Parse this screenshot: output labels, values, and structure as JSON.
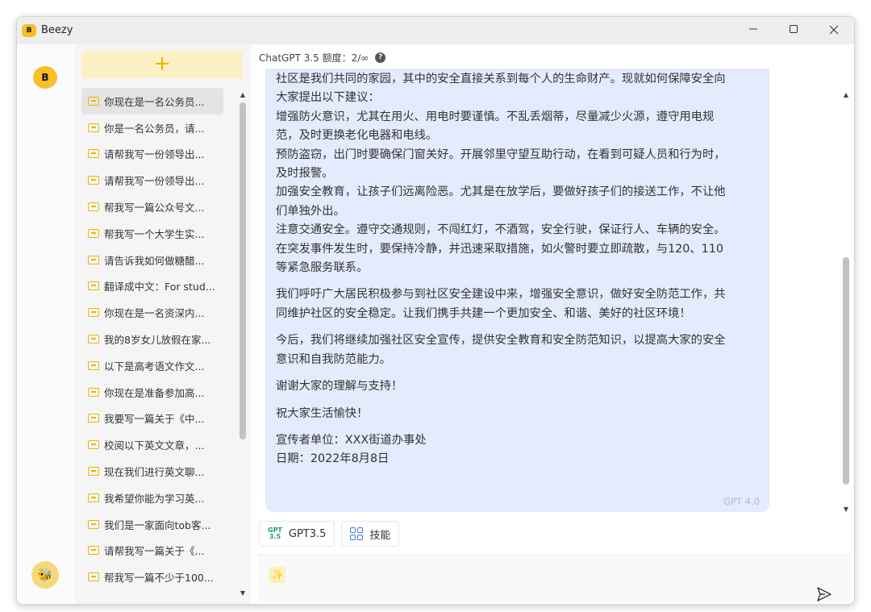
{
  "window": {
    "title": "Beezy"
  },
  "icons": {
    "app_logo": "beezy-logo-icon",
    "minimize": "minimize-icon",
    "maximize": "maximize-icon",
    "close": "close-icon",
    "new_chat": "plus-icon",
    "chat": "chat-bubble-icon",
    "help": "question-icon",
    "bee": "bee-icon",
    "wand": "magic-wand-icon",
    "send": "send-icon",
    "skills": "grid-icon"
  },
  "glyphs": {
    "app_logo": "B",
    "new_chat": "+",
    "help": "?",
    "wand": "✨",
    "bee": "🐝"
  },
  "colors": {
    "accent": "#f6c029",
    "message_bg": "#e3ebfc",
    "gpt_tag": "#a8bddf",
    "skill_icon": "#3d7be0",
    "gpt_badge": "#19a163"
  },
  "sidebar": {
    "items": [
      {
        "label": "你现在是一名公务员..."
      },
      {
        "label": "你是一名公务员，请..."
      },
      {
        "label": "请帮我写一份领导出..."
      },
      {
        "label": "请帮我写一份领导出..."
      },
      {
        "label": "帮我写一篇公众号文..."
      },
      {
        "label": "帮我写一个大学生实..."
      },
      {
        "label": "请告诉我如何做糖醋..."
      },
      {
        "label": "翻译成中文：For stud..."
      },
      {
        "label": "你现在是一名资深内..."
      },
      {
        "label": "我的8岁女儿放假在家..."
      },
      {
        "label": "以下是高考语文作文..."
      },
      {
        "label": "你现在是准备参加高..."
      },
      {
        "label": "我要写一篇关于《中..."
      },
      {
        "label": "校阅以下英文文章，..."
      },
      {
        "label": "现在我们进行英文聊..."
      },
      {
        "label": "我希望你能为学习英..."
      },
      {
        "label": "我们是一家面向tob客..."
      },
      {
        "label": "请帮我写一篇关于《..."
      },
      {
        "label": "帮我写一篇不少于100..."
      }
    ]
  },
  "main": {
    "model_quota": "ChatGPT 3.5 额度：2/∞",
    "message": {
      "paragraphs": [
        [
          "社区是我们共同的家园，其中的安全直接关系到每个人的生命财产。现就如何保障安全向",
          "大家提出以下建议：",
          "增强防火意识，尤其在用火、用电时要谨慎。不乱丢烟蒂，尽量减少火源，遵守用电规",
          "范，及时更换老化电器和电线。",
          "预防盗窃，出门时要确保门窗关好。开展邻里守望互助行动，在看到可疑人员和行为时，",
          "及时报警。",
          "加强安全教育，让孩子们远离险恶。尤其是在放学后，要做好孩子们的接送工作，不让他",
          "们单独外出。",
          "注意交通安全。遵守交通规则，不闯红灯，不酒驾，安全行驶，保证行人、车辆的安全。",
          "在突发事件发生时，要保持冷静，并迅速采取措施，如火警时要立即疏散，与120、110",
          "等紧急服务联系。"
        ],
        [
          "我们呼吁广大居民积极参与到社区安全建设中来，增强安全意识，做好安全防范工作，共",
          "同维护社区的安全稳定。让我们携手共建一个更加安全、和谐、美好的社区环境！"
        ],
        [
          "今后，我们将继续加强社区安全宣传，提供安全教育和安全防范知识，以提高大家的安全",
          "意识和自我防范能力。"
        ],
        [
          "谢谢大家的理解与支持！"
        ],
        [
          "祝大家生活愉快！"
        ],
        [
          "宣传者单位：XXX街道办事处",
          "日期：2022年8月8日"
        ]
      ],
      "model_tag": "GPT 4.0"
    },
    "toolbar": {
      "gpt_badge_top": "GPT",
      "gpt_badge_bottom": "3.5",
      "gpt_label": "GPT3.5",
      "skills_label": "技能"
    }
  }
}
